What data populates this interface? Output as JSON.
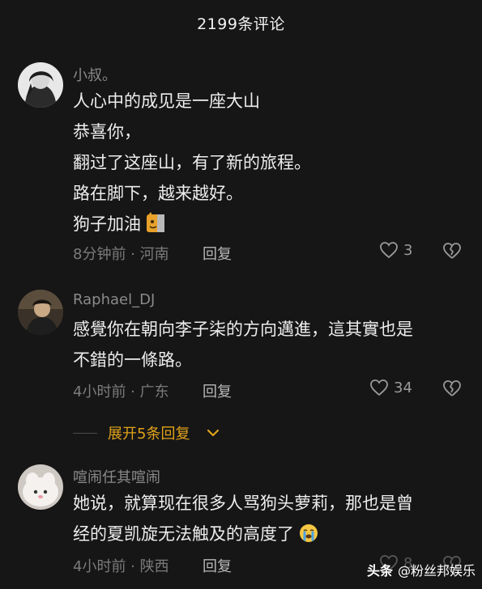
{
  "header": {
    "title": "2199条评论"
  },
  "comments": [
    {
      "username": "小叔。",
      "lines": [
        "人心中的成见是一座大山",
        "恭喜你，",
        "翻过了这座山，有了新的旅程。",
        "路在脚下，越来越好。",
        "狗子加油"
      ],
      "meta": "8分钟前 · 河南",
      "reply": "回复",
      "likes": "3"
    },
    {
      "username": "Raphael_DJ",
      "lines": [
        "感覺你在朝向李子柒的方向邁進，這其實也是",
        "不錯的一條路。"
      ],
      "meta": "4小时前 · 广东",
      "reply": "回复",
      "likes": "34"
    },
    {
      "username": "喧闹任其喧闹",
      "lines": [
        "她说，就算现在很多人骂狗头萝莉，那也是曾",
        "经的夏凯旋无法触及的高度了"
      ],
      "meta": "4小时前 · 陕西",
      "reply": "回复",
      "likes": "8"
    }
  ],
  "expand_replies": {
    "label": "展开5条回复"
  },
  "watermark": {
    "brand": "头条",
    "account": "@粉丝邦娱乐"
  },
  "colors": {
    "background": "#161616",
    "accent": "#e0a21b",
    "muted": "#7b7b7b"
  }
}
